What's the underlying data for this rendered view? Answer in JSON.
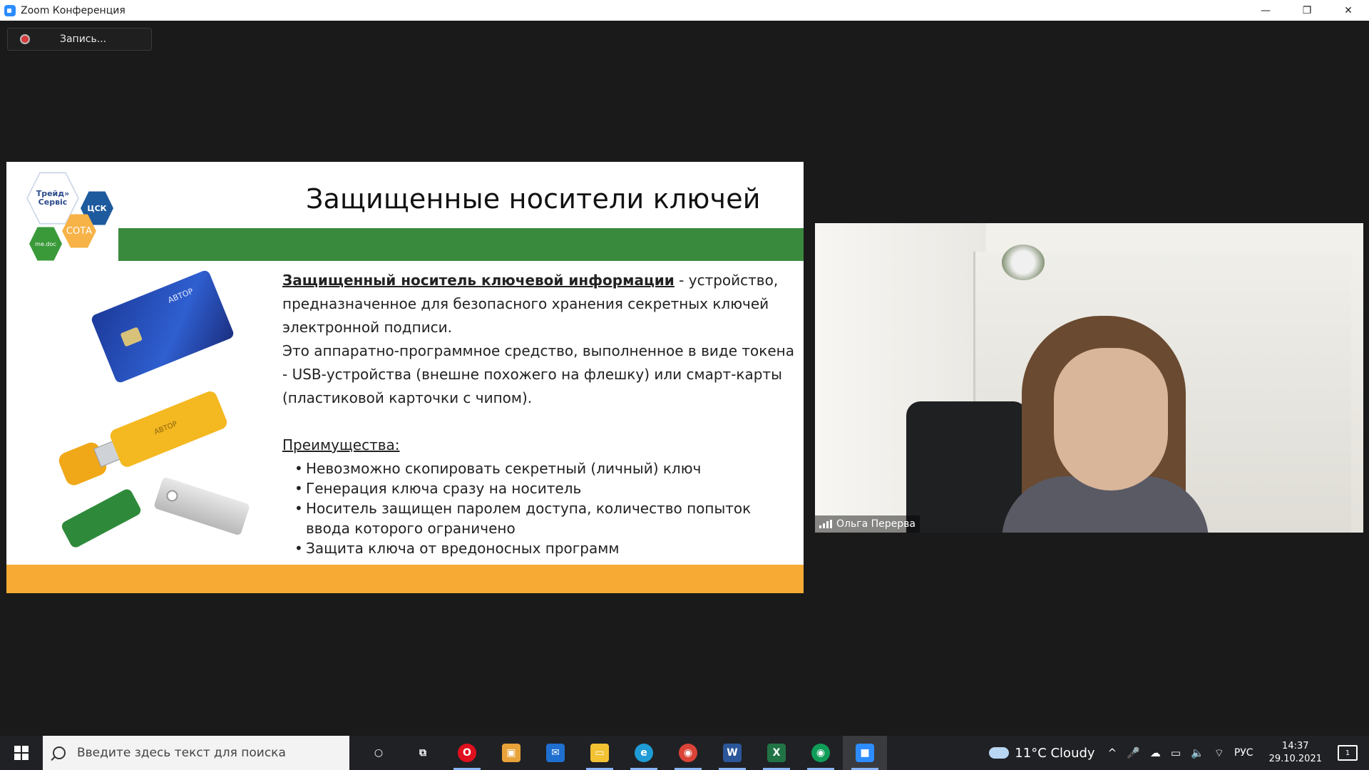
{
  "window": {
    "title": "Zoom Конференция",
    "controls": {
      "minimize": "—",
      "restore": "❐",
      "close": "✕"
    }
  },
  "recording": {
    "label": "Запись..."
  },
  "slide": {
    "title": "Защищенные носители ключей",
    "logos": {
      "trade": "Трейд» Сервіс",
      "csk": "ЦСК",
      "medoc": "me.doc",
      "sota": "СОТА"
    },
    "devices": {
      "card_brand": "АВТОР",
      "usb_brand": "АВТОР"
    },
    "definition_term": "Защищенный носитель ключевой информации",
    "definition_rest": " - устройство, предназначенное для безопасного хранения секретных ключей электронной подписи.",
    "description": "Это аппаратно-программное средство, выполненное в виде токена - USB-устройства (внешне похожего на флешку) или смарт-карты (пластиковой карточки с чипом).",
    "advantages_heading": "Преимущества:",
    "advantages": [
      "Невозможно скопировать секретный (личный) ключ",
      "Генерация ключа сразу на носитель",
      "Носитель защищен паролем доступа, количество попыток ввода которого ограничено",
      "Защита ключа от вредоносных программ"
    ],
    "colors": {
      "green_band": "#3a8a3d",
      "orange_band": "#f7ab35"
    }
  },
  "video": {
    "participant_name": "Ольга Перерва"
  },
  "taskbar": {
    "search_placeholder": "Введите здесь текст для поиска",
    "apps": [
      {
        "name": "cortana",
        "glyph": "○",
        "color": "#202124"
      },
      {
        "name": "task-view",
        "glyph": "⧉",
        "color": "#202124"
      },
      {
        "name": "opera",
        "glyph": "O",
        "color": "#e0101e"
      },
      {
        "name": "store",
        "glyph": "▣",
        "color": "#e8a23a"
      },
      {
        "name": "mail",
        "glyph": "✉",
        "color": "#1f6fd0"
      },
      {
        "name": "file-explorer",
        "glyph": "▭",
        "color": "#f2c233"
      },
      {
        "name": "edge",
        "glyph": "e",
        "color": "#1f9bd6"
      },
      {
        "name": "chrome",
        "glyph": "◉",
        "color": "#db4437"
      },
      {
        "name": "word",
        "glyph": "W",
        "color": "#2b579a"
      },
      {
        "name": "excel",
        "glyph": "X",
        "color": "#217346"
      },
      {
        "name": "chrome-profile",
        "glyph": "◉",
        "color": "#0f9d58"
      },
      {
        "name": "zoom",
        "glyph": "■",
        "color": "#2d8cff"
      }
    ],
    "weather": "11°C  Cloudy",
    "tray_icons": [
      "^",
      "🎤",
      "☁",
      "▭",
      "🔈",
      "⌔"
    ],
    "language": "РУС",
    "time": "14:37",
    "date": "29.10.2021",
    "notifications": "1"
  }
}
